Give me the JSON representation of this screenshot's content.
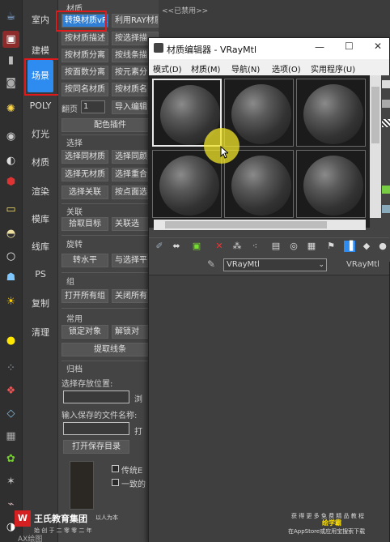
{
  "status": {
    "disabled": "<<已禁用>>"
  },
  "categories": [
    "室内",
    "建模",
    "场景",
    "POLY",
    "灯光",
    "材质",
    "渲染",
    "模库",
    "线库",
    "PS",
    "复制",
    "清理"
  ],
  "active_category": "场景",
  "panel": {
    "section_material": "材质",
    "buttons_material": [
      "转换材质vR",
      "利用RAY材质",
      "按材质描述",
      "按选择描",
      "按材质分离",
      "按线条描",
      "按面数分离",
      "按元素分",
      "按同名材质",
      "按材质名"
    ],
    "page_label": "翻页",
    "page_value": "1",
    "import_label": "导入编辑",
    "color_plugin": "配色插件",
    "section_select": "选择",
    "buttons_select": [
      "选择同材质",
      "选择同颜",
      "选择无材质",
      "选择重合",
      "选择关联",
      "按点面选"
    ],
    "section_relate": "关联",
    "buttons_relate": [
      "拾取目标",
      "关联选"
    ],
    "section_rotate": "旋转",
    "buttons_rotate": [
      "转水平",
      "与选择平"
    ],
    "section_group": "组",
    "buttons_group": [
      "打开所有组",
      "关闭所有"
    ],
    "section_common": "常用",
    "buttons_common": [
      "锁定对象",
      "解锁对",
      "提取线条"
    ],
    "section_archive": "归档",
    "save_location_label": "选择存放位置:",
    "browse_label": "浏",
    "filename_label": "输入保存的文件名称:",
    "open_short": "打",
    "open_save_dir": "打开保存目录",
    "check_1": "传统E",
    "check_2": "一致的"
  },
  "mat_editor": {
    "title": "材质编辑器 - VRayMtl",
    "menus": [
      "模式(D)",
      "材质(M)",
      "导航(N)",
      "选项(O)",
      "实用程序(U)"
    ],
    "material_name": "VRayMtl",
    "material_type": "VRayMtl"
  },
  "watermark": {
    "brand": "王氏教育集团",
    "tagline": "以人为本",
    "sub": "始 创 于 二 零 零 二 年",
    "right_line1": "获 得 更 多 免 费 精 品 教 程",
    "right_line2": "绘学霸",
    "right_line3": "在AppStore或应用宝搜索下载",
    "corner": "AX绘图"
  }
}
